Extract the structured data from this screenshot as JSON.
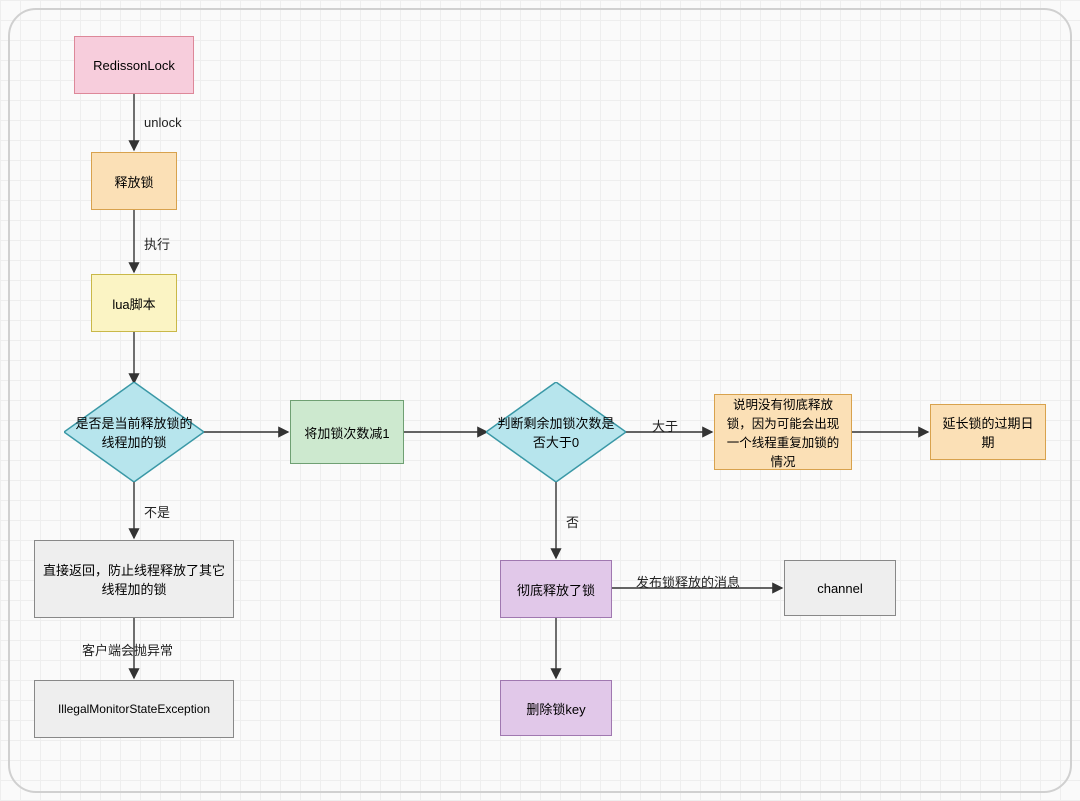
{
  "chart_data": {
    "type": "flowchart",
    "title": "RedissonLock unlock flow",
    "nodes": [
      {
        "id": "n_start",
        "type": "start",
        "label": "RedissonLock",
        "color": "pink"
      },
      {
        "id": "n_release",
        "type": "process",
        "label": "释放锁",
        "color": "orange"
      },
      {
        "id": "n_lua",
        "type": "process",
        "label": "lua脚本",
        "color": "yellow"
      },
      {
        "id": "d_current",
        "type": "decision",
        "label": "是否是当前释放锁的线程加的锁",
        "color": "cyan"
      },
      {
        "id": "n_return",
        "type": "process",
        "label": "直接返回，防止线程释放了其它线程加的锁",
        "color": "gray"
      },
      {
        "id": "n_ex",
        "type": "process",
        "label": "IllegalMonitorStateException",
        "color": "gray"
      },
      {
        "id": "n_dec",
        "type": "process",
        "label": "将加锁次数减1",
        "color": "green"
      },
      {
        "id": "d_gt0",
        "type": "decision",
        "label": "判断剩余加锁次数是否大于0",
        "color": "cyan"
      },
      {
        "id": "n_explain",
        "type": "process",
        "label": "说明没有彻底释放锁，因为可能会出现一个线程重复加锁的情况",
        "color": "orange"
      },
      {
        "id": "n_extend",
        "type": "process",
        "label": "延长锁的过期日期",
        "color": "orange"
      },
      {
        "id": "n_full",
        "type": "process",
        "label": "彻底释放了锁",
        "color": "purple"
      },
      {
        "id": "n_channel",
        "type": "process",
        "label": "channel",
        "color": "gray"
      },
      {
        "id": "n_delkey",
        "type": "process",
        "label": "删除锁key",
        "color": "purple"
      }
    ],
    "edges": [
      {
        "from": "n_start",
        "to": "n_release",
        "label": "unlock"
      },
      {
        "from": "n_release",
        "to": "n_lua",
        "label": "执行"
      },
      {
        "from": "n_lua",
        "to": "d_current",
        "label": ""
      },
      {
        "from": "d_current",
        "to": "n_return",
        "label": "不是"
      },
      {
        "from": "n_return",
        "to": "n_ex",
        "label": "客户端会抛异常"
      },
      {
        "from": "d_current",
        "to": "n_dec",
        "label": ""
      },
      {
        "from": "n_dec",
        "to": "d_gt0",
        "label": ""
      },
      {
        "from": "d_gt0",
        "to": "n_explain",
        "label": "大于"
      },
      {
        "from": "n_explain",
        "to": "n_extend",
        "label": ""
      },
      {
        "from": "d_gt0",
        "to": "n_full",
        "label": "否"
      },
      {
        "from": "n_full",
        "to": "n_channel",
        "label": "发布锁释放的消息"
      },
      {
        "from": "n_full",
        "to": "n_delkey",
        "label": ""
      }
    ]
  },
  "labels": {
    "unlock": "unlock",
    "exec": "执行",
    "not": "不是",
    "client_throw": "客户端会抛异常",
    "gt": "大于",
    "no": "否",
    "publish": "发布锁释放的消息"
  },
  "nodes": {
    "start": "RedissonLock",
    "release": "释放锁",
    "lua": "lua脚本",
    "d_current": "是否是当前释放锁的线程加的锁",
    "return": "直接返回，防止线程释放了其它线程加的锁",
    "ex": "IllegalMonitorStateException",
    "dec": "将加锁次数减1",
    "d_gt0": "判断剩余加锁次数是否大于0",
    "explain": "说明没有彻底释放锁，因为可能会出现一个线程重复加锁的情况",
    "extend": "延长锁的过期日期",
    "full": "彻底释放了锁",
    "channel": "channel",
    "delkey": "删除锁key"
  }
}
